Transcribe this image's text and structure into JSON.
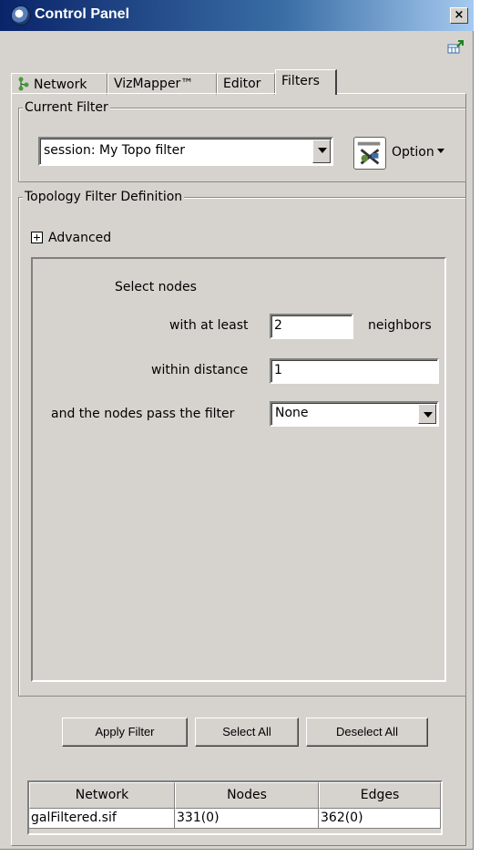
{
  "window": {
    "title": "Control Panel",
    "close_label": "×"
  },
  "tabs": [
    {
      "label": "Network"
    },
    {
      "label": "VizMapper™"
    },
    {
      "label": "Editor"
    },
    {
      "label": "Filters"
    }
  ],
  "current_filter": {
    "group_title": "Current Filter",
    "selected": "session: My Topo filter",
    "option_label": "Option"
  },
  "topology": {
    "group_title": "Topology Filter Definition",
    "advanced_label": "Advanced",
    "select_nodes_label": "Select nodes",
    "at_least_label": "with at least",
    "at_least_value": "2",
    "neighbors_label": "neighbors",
    "distance_label": "within distance",
    "distance_value": "1",
    "pass_filter_label": "and the nodes pass the filter",
    "pass_filter_value": "None"
  },
  "buttons": {
    "apply": "Apply Filter",
    "select_all": "Select All",
    "deselect_all": "Deselect All"
  },
  "status_table": {
    "headers": [
      "Network",
      "Nodes",
      "Edges"
    ],
    "rows": [
      [
        "galFiltered.sif",
        "331(0)",
        "362(0)"
      ]
    ]
  }
}
